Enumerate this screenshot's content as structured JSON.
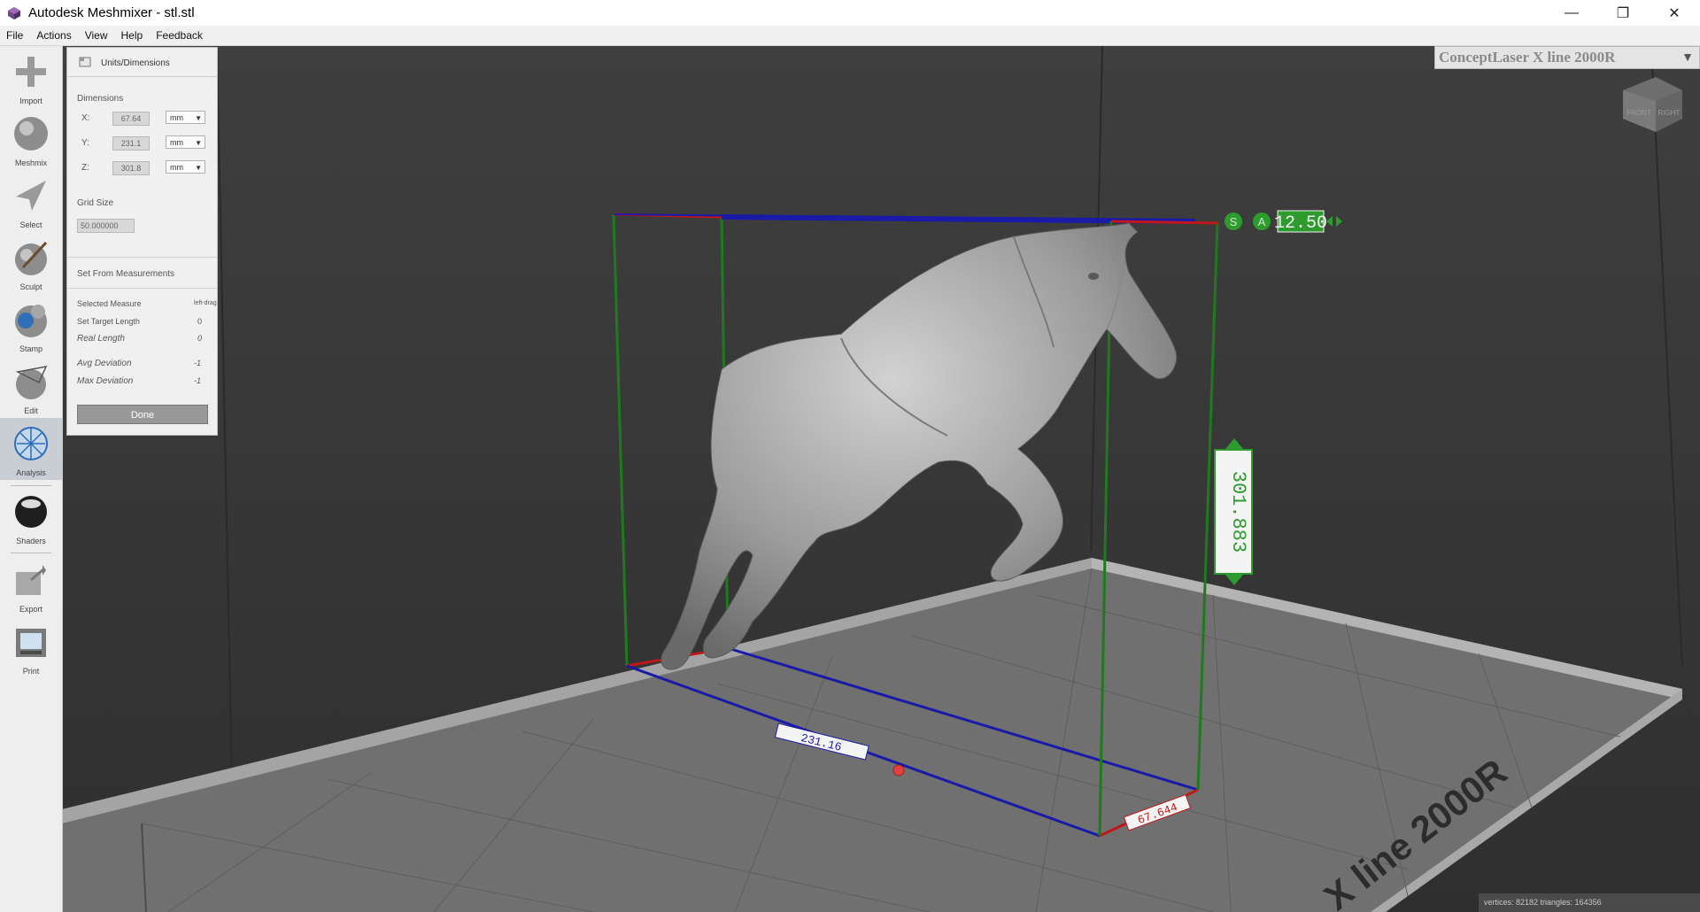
{
  "window": {
    "title": "Autodesk Meshmixer - stl.stl",
    "minimize_glyph": "—",
    "maximize_glyph": "❐",
    "close_glyph": "✕"
  },
  "menu": [
    "File",
    "Actions",
    "View",
    "Help",
    "Feedback"
  ],
  "tools": [
    {
      "label": "Import",
      "icon": "plus-icon"
    },
    {
      "label": "Meshmix",
      "icon": "bunny-sphere-icon"
    },
    {
      "label": "Select",
      "icon": "arrow-cursor-icon"
    },
    {
      "label": "Sculpt",
      "icon": "brush-sphere-icon"
    },
    {
      "label": "Stamp",
      "icon": "stamp-sphere-icon"
    },
    {
      "label": "Edit",
      "icon": "edit-sphere-icon"
    },
    {
      "label": "Analysis",
      "icon": "analysis-sphere-icon",
      "active": true
    },
    {
      "label": "Shaders",
      "icon": "shader-sphere-icon"
    },
    {
      "label": "Export",
      "icon": "export-icon"
    },
    {
      "label": "Print",
      "icon": "printer-icon"
    }
  ],
  "panel": {
    "title": "Units/Dimensions",
    "dimensions_label": "Dimensions",
    "x_label": "X:",
    "x_value": "67.64",
    "x_unit": "mm",
    "y_label": "Y:",
    "y_value": "231.1",
    "y_unit": "mm",
    "z_label": "Z:",
    "z_value": "301.8",
    "z_unit": "mm",
    "grid_size_label": "Grid Size",
    "grid_size_value": "50.000000",
    "set_from_label": "Set From Measurements",
    "selected_measure_label": "Selected Measure",
    "selected_measure_value": "left-drag",
    "set_target_label": "Set Target Length",
    "set_target_value": "0",
    "real_length_label": "Real Length",
    "real_length_value": "0",
    "avg_dev_label": "Avg Deviation",
    "avg_dev_value": "-1",
    "max_dev_label": "Max Deviation",
    "max_dev_value": "-1",
    "done_label": "Done"
  },
  "printer": {
    "name": "ConceptLaser X line 2000R",
    "bed_label": "X line 2000R"
  },
  "viewcube": {
    "front": "FRONT",
    "right": "RIGHT"
  },
  "gizmo": {
    "s_label": "S",
    "a_label": "A",
    "value": "12.50"
  },
  "measurements": {
    "height": "301.883",
    "depth": "231.16",
    "width": "67.644"
  },
  "status": {
    "text": "vertices: 82182  triangles: 164356"
  },
  "colors": {
    "accent_green": "#2e9b2e",
    "box_blue": "#1a1aa8",
    "box_green": "#1f7a1f",
    "box_red": "#c0181a"
  }
}
